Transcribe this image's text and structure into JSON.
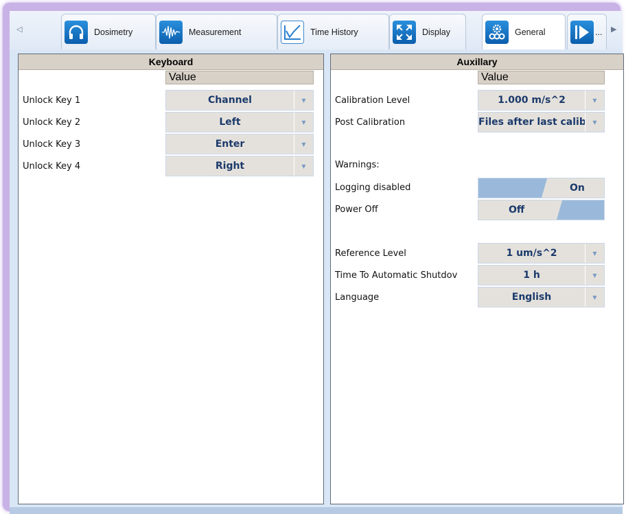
{
  "tabs": [
    {
      "label": "Dosimetry",
      "icon": "headphones-icon"
    },
    {
      "label": "Measurement",
      "icon": "waveform-icon"
    },
    {
      "label": "Time History",
      "icon": "line-graph-icon"
    },
    {
      "label": "Display",
      "icon": "expand-arrows-icon"
    },
    {
      "label": "General",
      "icon": "gears-icon",
      "active": true
    },
    {
      "label": "...",
      "icon": "play-next-icon"
    }
  ],
  "keyboard": {
    "title": "Keyboard",
    "value_header": "Value",
    "rows": [
      {
        "label": "Unlock Key 1",
        "value": "Channel"
      },
      {
        "label": "Unlock Key 2",
        "value": "Left"
      },
      {
        "label": "Unlock Key 3",
        "value": "Enter"
      },
      {
        "label": "Unlock Key 4",
        "value": "Right"
      }
    ]
  },
  "auxillary": {
    "title": "Auxillary",
    "value_header": "Value",
    "calibration_level": {
      "label": "Calibration Level",
      "value": "1.000 m/s^2"
    },
    "post_calibration": {
      "label": "Post Calibration",
      "value": "Files after last calibra"
    },
    "warnings_label": "Warnings:",
    "logging_disabled": {
      "label": "Logging disabled",
      "value": "On"
    },
    "power_off": {
      "label": "Power Off",
      "value": "Off"
    },
    "reference_level": {
      "label": "Reference Level",
      "value": "1 um/s^2"
    },
    "auto_shutdown": {
      "label": "Time To Automatic Shutdov",
      "value": "1 h"
    },
    "language": {
      "label": "Language",
      "value": "English"
    }
  },
  "colors": {
    "accent": "#1c3a6b",
    "toggle_fill": "#9ab9da",
    "frame": "#c9b2e6"
  }
}
